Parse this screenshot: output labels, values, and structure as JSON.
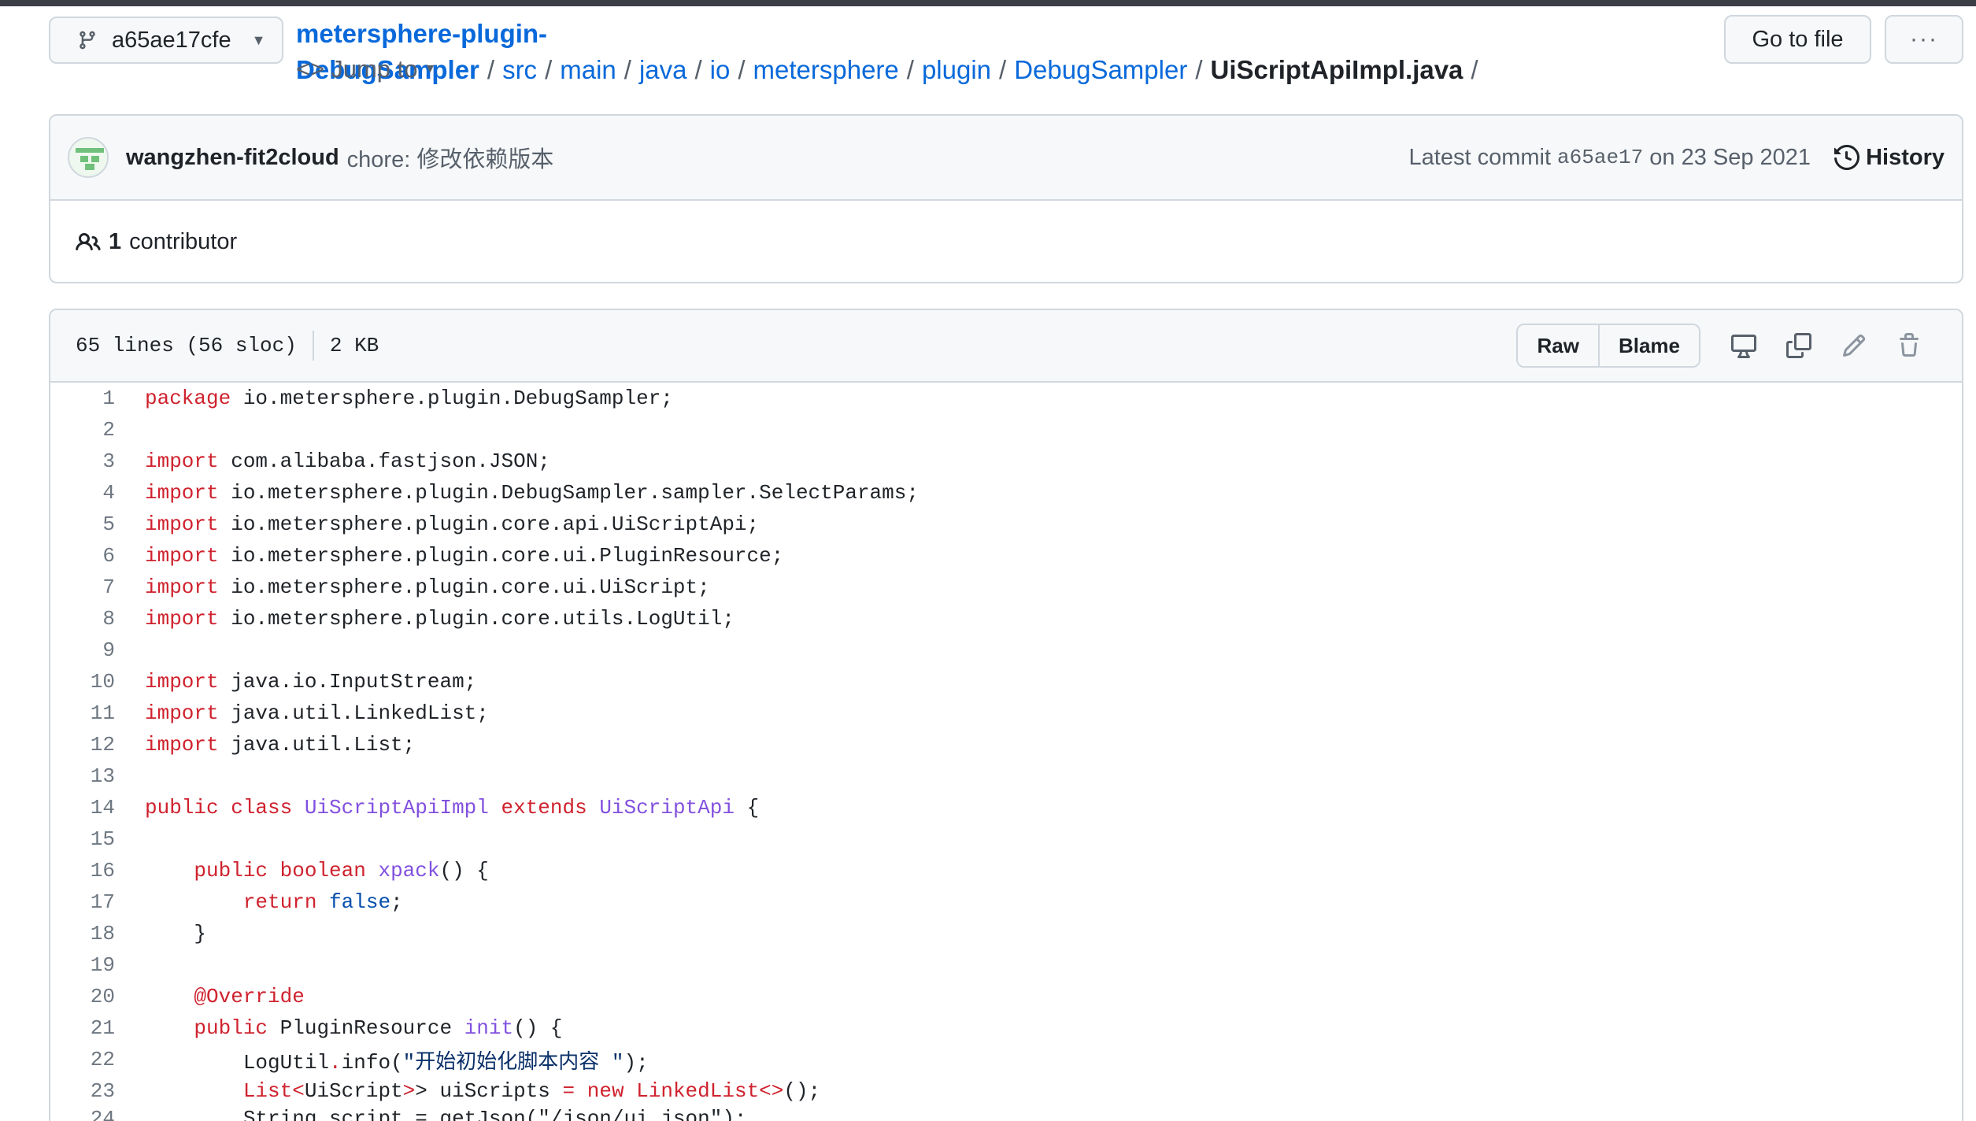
{
  "branch": {
    "name": "a65ae17cfe"
  },
  "breadcrumb": {
    "repo": "metersphere-plugin-DebugSampler",
    "parts": [
      "src",
      "main",
      "java",
      "io",
      "metersphere",
      "plugin",
      "DebugSampler"
    ],
    "file": "UiScriptApiImpl.java",
    "sep": "/",
    "jump_to": "Jump to"
  },
  "actions": {
    "goto_file": "Go to file",
    "more": "···"
  },
  "commit": {
    "author": "wangzhen-fit2cloud",
    "message": "chore: 修改依赖版本",
    "latest_label": "Latest commit",
    "sha": "a65ae17",
    "date": "on 23 Sep 2021",
    "history_label": "History"
  },
  "contributors": {
    "count": "1",
    "label": "contributor"
  },
  "file": {
    "lines_info": "65 lines (56 sloc)",
    "size": "2 KB",
    "raw_label": "Raw",
    "blame_label": "Blame"
  },
  "code": {
    "line_numbers": [
      "1",
      "2",
      "3",
      "4",
      "5",
      "6",
      "7",
      "8",
      "9",
      "10",
      "11",
      "12",
      "13",
      "14",
      "15",
      "16",
      "17",
      "18",
      "19",
      "20",
      "21",
      "22",
      "23",
      "24"
    ],
    "l1_kw": "package",
    "l1_rest": " io.metersphere.plugin.DebugSampler;",
    "l3_kw": "import",
    "l3_rest": " com.alibaba.fastjson.JSON;",
    "l4_kw": "import",
    "l4_rest": " io.metersphere.plugin.DebugSampler.sampler.SelectParams;",
    "l5_kw": "import",
    "l5_rest": " io.metersphere.plugin.core.api.UiScriptApi;",
    "l6_kw": "import",
    "l6_rest": " io.metersphere.plugin.core.ui.PluginResource;",
    "l7_kw": "import",
    "l7_rest": " io.metersphere.plugin.core.ui.UiScript;",
    "l8_kw": "import",
    "l8_rest": " io.metersphere.plugin.core.utils.LogUtil;",
    "l10_kw": "import",
    "l10_rest": " java.io.InputStream;",
    "l11_kw": "import",
    "l11_rest": " java.util.LinkedList;",
    "l12_kw": "import",
    "l12_rest": " java.util.List;",
    "l14_kw1": "public class",
    "l14_cls": "UiScriptApiImpl",
    "l14_kw2": "extends",
    "l14_sup": "UiScriptApi",
    "l14_end": " {",
    "l16_kw": "public boolean",
    "l16_fn": "xpack",
    "l16_end": "() {",
    "l17_kw": "return",
    "l17_val": "false",
    "l17_end": ";",
    "l18": "}",
    "l20_ann": "@Override",
    "l21_kw": "public",
    "l21_type": " PluginResource ",
    "l21_fn": "init",
    "l21_end": "() {",
    "l22_a": "LogUtil",
    "l22_dot": ".",
    "l22_b": "info(",
    "l22_str": "\"开始初始化脚本内容 \"",
    "l22_end": ");",
    "l23_a": "List<",
    "l23_b": "UiScript",
    "l23_c": "> uiScripts ",
    "l23_eq": "=",
    "l23_sp": " ",
    "l23_new": "new",
    "l23_d": " LinkedList<>",
    "l23_end": "();",
    "l24_partial": "String script = getJson(\"/json/ui.json\");"
  }
}
